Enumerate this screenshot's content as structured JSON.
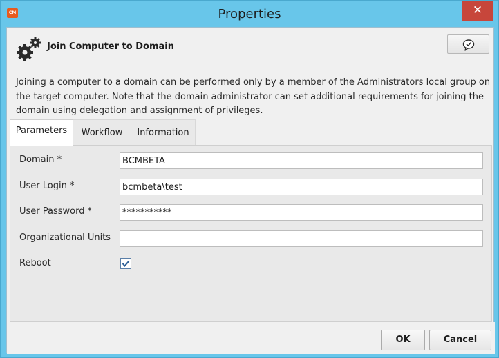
{
  "window": {
    "title": "Properties",
    "app_icon_text": "CM",
    "close_glyph": "✕"
  },
  "header": {
    "title": "Join Computer to Domain",
    "icon": "gears-icon",
    "chat_icon": "speech-bubble-check-icon"
  },
  "description": "Joining a computer to a domain can be performed only by a member of the Administrators local group on the target computer. Note that the domain administrator can set additional requirements for joining the domain using delegation and assignment of privileges.",
  "tabs": [
    {
      "label": "Parameters",
      "active": true
    },
    {
      "label": "Workflow",
      "active": false
    },
    {
      "label": "Information",
      "active": false
    }
  ],
  "form": {
    "domain": {
      "label": "Domain *",
      "value": "BCMBETA"
    },
    "user_login": {
      "label": "User Login *",
      "value": "bcmbeta\\test"
    },
    "user_password": {
      "label": "User Password *",
      "value": "***********"
    },
    "org_units": {
      "label": "Organizational Units",
      "value": ""
    },
    "reboot": {
      "label": "Reboot",
      "checked": true
    }
  },
  "buttons": {
    "ok": "OK",
    "cancel": "Cancel"
  },
  "colors": {
    "titlebar": "#68c6ea",
    "close": "#c7463b",
    "app_icon": "#e85b1e"
  }
}
